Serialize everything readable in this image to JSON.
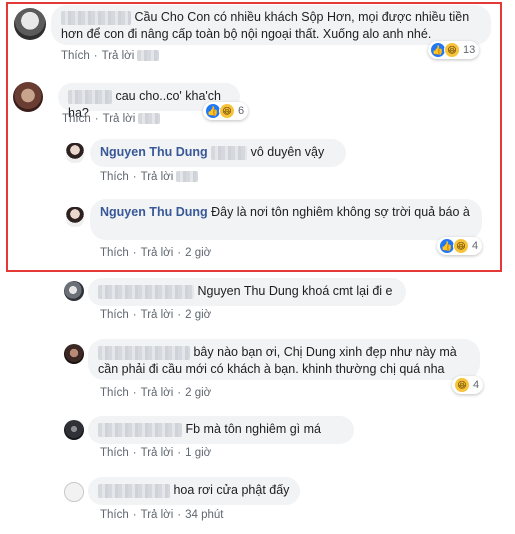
{
  "actions": {
    "like": "Thích",
    "reply": "Trả lời",
    "sep": "·"
  },
  "colors": {
    "highlight_border": "#e53935",
    "name_link": "#385898",
    "like_blue": "#2078f4",
    "haha_yellow": "#f7c33a"
  },
  "comments": [
    {
      "text": "Cầu Cho Con có nhiều khách Sộp Hơn, mọi được nhiều tiền hơn để con đi nâng cấp toàn bộ nội ngoại thất. Xuống alo anh nhé.",
      "reactions": "13",
      "time": ""
    },
    {
      "text": "cau cho..co' kha'ch ha?",
      "reactions": "6",
      "time": ""
    },
    {
      "name": "Nguyen Thu Dung",
      "text": "vô duyên vậy",
      "time": ""
    },
    {
      "name": "Nguyen Thu Dung",
      "text": "Đây là nơi tôn nghiêm không sợ trời quả báo à",
      "reactions": "4",
      "time": "2 giờ"
    },
    {
      "text": "Nguyen Thu Dung khoá cmt lại đi e",
      "time": "2 giờ"
    },
    {
      "text": "bây nào bạn ơi, Chị Dung xinh đẹp như này mà cần phải đi cầu mới có khách à bạn. khinh thường chị quá nha",
      "reactions": "4",
      "time": "2 giờ"
    },
    {
      "text": "Fb mà tôn nghiêm gì má",
      "time": "1 giờ"
    },
    {
      "text": "hoa rơi cửa phật đấy",
      "time": "34 phút"
    }
  ]
}
